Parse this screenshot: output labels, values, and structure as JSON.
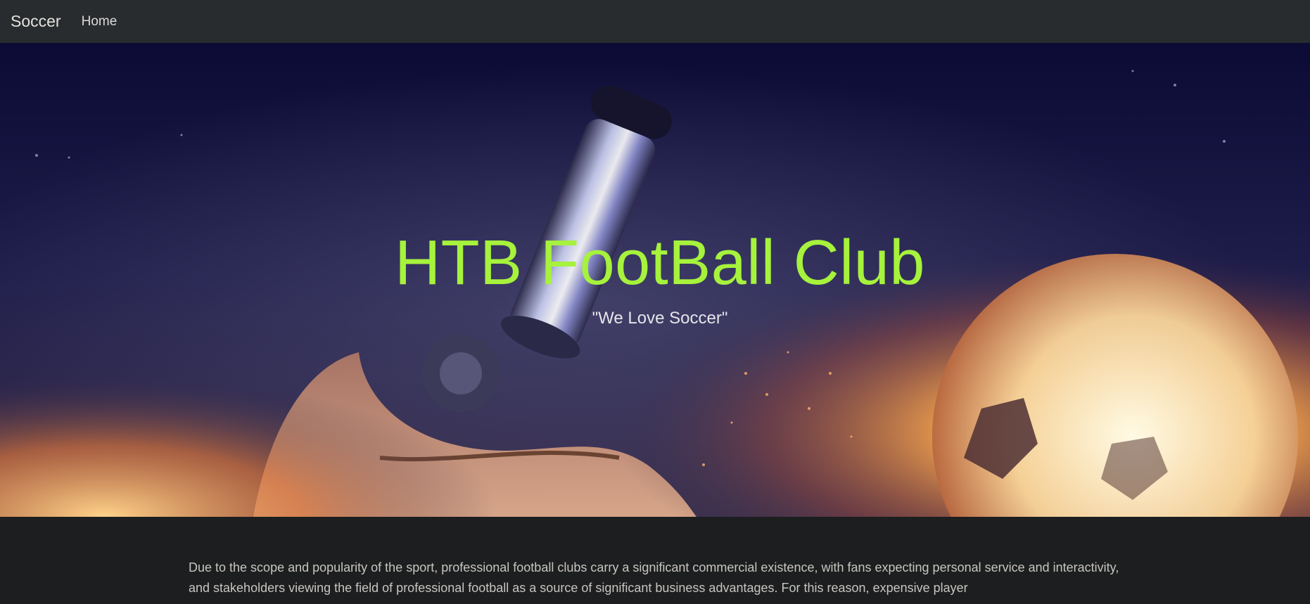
{
  "navbar": {
    "brand": "Soccer",
    "links": [
      {
        "label": "Home"
      }
    ]
  },
  "hero": {
    "title": "HTB FootBall Club",
    "subtitle": "\"We Love Soccer\"",
    "background_image": "night-sky-cleat-flaming-soccer-ball",
    "colors": {
      "title": "#a6f23c",
      "subtitle": "#e6e4ea",
      "background": "#141437"
    }
  },
  "content": {
    "paragraph": "Due to the scope and popularity of the sport, professional football clubs carry a significant commercial existence, with fans expecting personal service and interactivity, and stakeholders viewing the field of professional football as a source of significant business advantages. For this reason, expensive player"
  },
  "colors": {
    "navbar_bg": "#282c2e",
    "page_bg": "#1c1e1f",
    "body_text": "#c8c5c0"
  }
}
